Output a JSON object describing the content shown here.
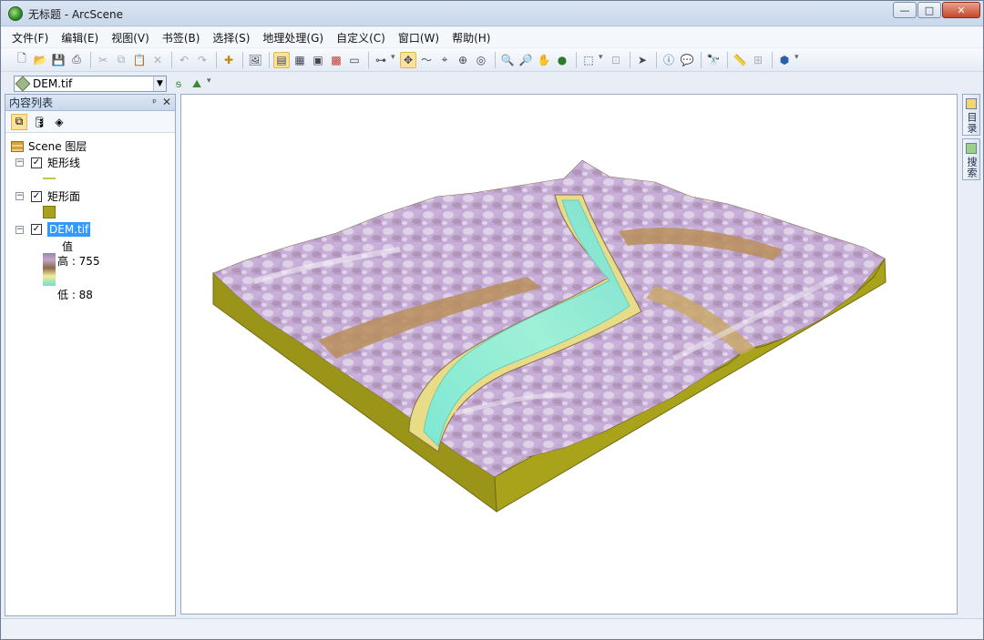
{
  "window": {
    "title": "无标题 - ArcScene",
    "buttons": {
      "minimize": "—",
      "maximize": "□",
      "close": "✕"
    }
  },
  "menu": [
    "文件(F)",
    "编辑(E)",
    "视图(V)",
    "书签(B)",
    "选择(S)",
    "地理处理(G)",
    "自定义(C)",
    "窗口(W)",
    "帮助(H)"
  ],
  "layer_selector": {
    "value": "DEM.tif"
  },
  "toc": {
    "title": "内容列表",
    "pin": "ᵖ",
    "close": "✕",
    "root": "Scene 图层",
    "layers": [
      {
        "name": "矩形线",
        "checked": true
      },
      {
        "name": "矩形面",
        "checked": true
      },
      {
        "name": "DEM.tif",
        "checked": true,
        "selected": true
      }
    ],
    "legend": {
      "field": "值",
      "high": "高 : 755",
      "low": "低 : 88"
    }
  },
  "right_dock": [
    {
      "label": "目录",
      "icon": "catalog-icon"
    },
    {
      "label": "搜索",
      "icon": "search-icon"
    }
  ],
  "colors": {
    "base": "#9a9518",
    "base_dark": "#6f6b0f",
    "river": "#7be8cf",
    "terrain": "#c4a9d3"
  }
}
